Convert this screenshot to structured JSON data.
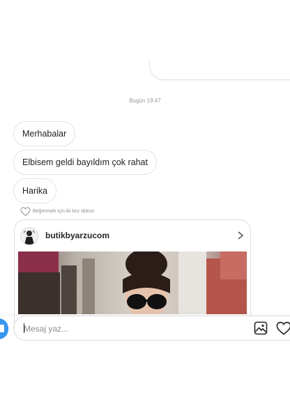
{
  "thread": {
    "timestamp": "Bugün 19:47",
    "messages": [
      {
        "text": "Merhabalar"
      },
      {
        "text": "Elbisem geldi bayıldım çok rahat"
      },
      {
        "text": "Harika"
      }
    ],
    "like_hint": "Beğenmek için iki kez dokun"
  },
  "shared_post": {
    "username": "butikbyarzucom",
    "avatar_icon": "profile-photo",
    "chevron_icon": "chevron-right-icon"
  },
  "composer": {
    "placeholder": "Mesaj yaz...",
    "value": "",
    "icons": [
      "camera-icon",
      "gallery-icon",
      "heart-icon"
    ]
  },
  "colors": {
    "accent": "#3897f0",
    "bubble_border": "#e3e3e3",
    "muted_text": "#8e8e8e"
  }
}
